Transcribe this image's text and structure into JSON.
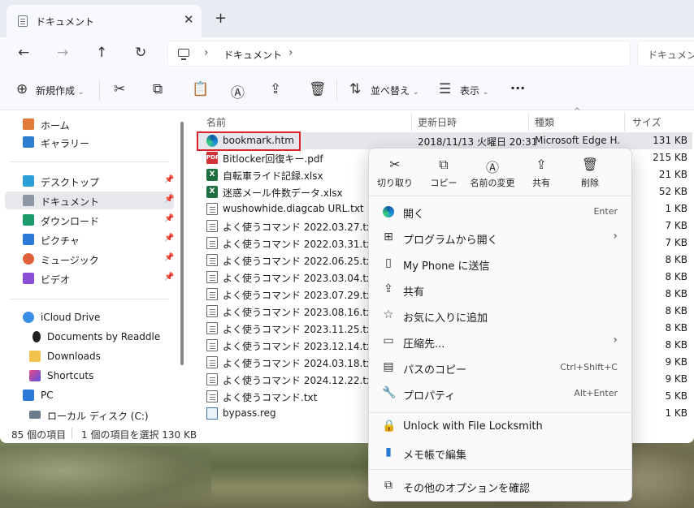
{
  "window": {
    "tab_title": "ドキュメント",
    "tab_close": "✕",
    "new_tab": "+",
    "breadcrumb": "ドキュメント",
    "search_placeholder": "ドキュメント"
  },
  "toolbar": {
    "new_label": "新規作成",
    "sort_label": "並べ替え",
    "view_label": "表示",
    "more": "···"
  },
  "sidebar": {
    "items": [
      {
        "label": "ホーム",
        "icon": "home-icon",
        "color": "#e07b39"
      },
      {
        "label": "ギャラリー",
        "icon": "gallery-icon",
        "color": "#2f7fd1"
      },
      {
        "label": "デスクトップ",
        "icon": "desktop-icon",
        "color": "#2b9fd8",
        "pinned": true
      },
      {
        "label": "ドキュメント",
        "icon": "documents-icon",
        "color": "#8d96a3",
        "pinned": true
      },
      {
        "label": "ダウンロード",
        "icon": "download-icon",
        "color": "#1c9b6a",
        "pinned": true
      },
      {
        "label": "ピクチャ",
        "icon": "pictures-icon",
        "color": "#2a7ad6",
        "pinned": true
      },
      {
        "label": "ミュージック",
        "icon": "music-icon",
        "color": "#e0603a",
        "pinned": true
      },
      {
        "label": "ビデオ",
        "icon": "video-icon",
        "color": "#8a4fd6",
        "pinned": true
      },
      {
        "label": "iCloud Drive",
        "icon": "icloud-icon",
        "color": "#3a8ee6"
      },
      {
        "label": "Documents by Readdle",
        "icon": "readdle-icon",
        "color": "#222222"
      },
      {
        "label": "Downloads",
        "icon": "folder-icon",
        "color": "#f2c34b"
      },
      {
        "label": "Shortcuts",
        "icon": "shortcuts-icon",
        "color": "#7a4fd6"
      },
      {
        "label": "PC",
        "icon": "pc-icon",
        "color": "#2a7ad6"
      },
      {
        "label": "ローカル ディスク (C:)",
        "icon": "drive-icon",
        "color": "#6a7b8c"
      }
    ]
  },
  "columns": {
    "name": "名前",
    "date": "更新日時",
    "type": "種類",
    "size": "サイズ"
  },
  "files": [
    {
      "name": "bookmark.htm",
      "date": "2018/11/13 火曜日 20:31",
      "type": "Microsoft Edge H...",
      "size": "131 KB",
      "kind": "edge"
    },
    {
      "name": "Bitlocker回復キー.pdf",
      "size": "215 KB",
      "kind": "pdf"
    },
    {
      "name": "自転車ライド記録.xlsx",
      "size": "21 KB",
      "kind": "xls"
    },
    {
      "name": "迷惑メール件数データ.xlsx",
      "size": "52 KB",
      "kind": "xls"
    },
    {
      "name": "wushowhide.diagcab URL.txt",
      "size": "1 KB",
      "kind": "txt"
    },
    {
      "name": "よく使うコマンド 2022.03.27.txt",
      "size": "7 KB",
      "kind": "txt"
    },
    {
      "name": "よく使うコマンド 2022.03.31.txt",
      "size": "7 KB",
      "kind": "txt"
    },
    {
      "name": "よく使うコマンド 2022.06.25.txt",
      "size": "8 KB",
      "kind": "txt"
    },
    {
      "name": "よく使うコマンド 2023.03.04.txt",
      "size": "8 KB",
      "kind": "txt"
    },
    {
      "name": "よく使うコマンド 2023.07.29.txt",
      "size": "8 KB",
      "kind": "txt"
    },
    {
      "name": "よく使うコマンド 2023.08.16.txt",
      "size": "8 KB",
      "kind": "txt"
    },
    {
      "name": "よく使うコマンド 2023.11.25.txt",
      "size": "8 KB",
      "kind": "txt"
    },
    {
      "name": "よく使うコマンド 2023.12.14.txt",
      "size": "8 KB",
      "kind": "txt"
    },
    {
      "name": "よく使うコマンド 2024.03.18.txt",
      "size": "9 KB",
      "kind": "txt"
    },
    {
      "name": "よく使うコマンド 2024.12.22.txt",
      "size": "9 KB",
      "kind": "txt"
    },
    {
      "name": "よく使うコマンド.txt",
      "size": "5 KB",
      "kind": "txt"
    },
    {
      "name": "bypass.reg",
      "size": "1 KB",
      "kind": "reg"
    }
  ],
  "status": {
    "count": "85 個の項目",
    "selected": "1 個の項目を選択  130 KB"
  },
  "context_menu": {
    "quick_actions": [
      {
        "label": "切り取り",
        "icon": "cut-icon",
        "glyph": "✂"
      },
      {
        "label": "コピー",
        "icon": "copy-icon",
        "glyph": "⧉"
      },
      {
        "label": "名前の変更",
        "icon": "rename-icon",
        "glyph": "Ⓐ"
      },
      {
        "label": "共有",
        "icon": "share-icon",
        "glyph": "⇪"
      },
      {
        "label": "削除",
        "icon": "delete-icon",
        "glyph": "🗑"
      }
    ],
    "items": [
      {
        "label": "開く",
        "shortcut": "Enter",
        "icon": "edge-icon"
      },
      {
        "label": "プログラムから開く",
        "arrow": "›",
        "icon": "open-with-icon"
      },
      {
        "label": "My Phone に送信",
        "icon": "phone-icon"
      },
      {
        "label": "共有",
        "icon": "share-icon"
      },
      {
        "label": "お気に入りに追加",
        "icon": "star-icon"
      },
      {
        "label": "圧縮先...",
        "arrow": "›",
        "icon": "zip-icon"
      },
      {
        "label": "パスのコピー",
        "shortcut": "Ctrl+Shift+C",
        "icon": "copy-path-icon"
      },
      {
        "label": "プロパティ",
        "shortcut": "Alt+Enter",
        "icon": "properties-icon"
      },
      {
        "label": "Unlock with File Locksmith",
        "icon": "lock-icon"
      },
      {
        "label": "メモ帳で編集",
        "icon": "notepad-icon"
      },
      {
        "label": "その他のオプションを確認",
        "icon": "more-options-icon"
      }
    ]
  }
}
